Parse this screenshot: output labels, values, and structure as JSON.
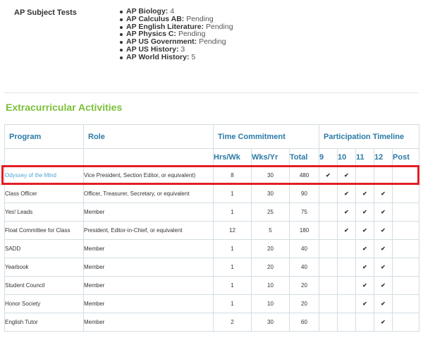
{
  "ap": {
    "label": "AP Subject Tests",
    "items": [
      {
        "subject": "AP Biology:",
        "status": "4"
      },
      {
        "subject": "AP Calculus AB:",
        "status": "Pending"
      },
      {
        "subject": "AP English Literature:",
        "status": "Pending"
      },
      {
        "subject": "AP Physics C:",
        "status": "Pending"
      },
      {
        "subject": "AP US Government:",
        "status": "Pending"
      },
      {
        "subject": "AP US History:",
        "status": "3"
      },
      {
        "subject": "AP World History:",
        "status": "5"
      }
    ]
  },
  "section_title": "Extracurricular Activities",
  "table": {
    "headers": {
      "program": "Program",
      "role": "Role",
      "time_commitment": "Time Commitment",
      "participation": "Participation Timeline",
      "hrs": "Hrs/Wk",
      "wks": "Wks/Yr",
      "total": "Total",
      "g9": "9",
      "g10": "10",
      "g11": "11",
      "g12": "12",
      "post": "Post"
    },
    "check_symbol": "✔",
    "rows": [
      {
        "program": "Odyssey of the Mind",
        "role": "Vice President, Section Editor, or equivalent)",
        "hrs": "8",
        "wks": "30",
        "total": "480",
        "g9": true,
        "g10": true,
        "g11": false,
        "g12": false,
        "post": false
      },
      {
        "program": "Class Officer",
        "role": "Officer, Treasurer, Secretary, or equivalent",
        "hrs": "1",
        "wks": "30",
        "total": "90",
        "g9": false,
        "g10": true,
        "g11": true,
        "g12": true,
        "post": false
      },
      {
        "program": "Yes! Leads",
        "role": "Member",
        "hrs": "1",
        "wks": "25",
        "total": "75",
        "g9": false,
        "g10": true,
        "g11": true,
        "g12": true,
        "post": false
      },
      {
        "program": "Float Committee for Class",
        "role": "President, Editor-in-Chief, or equivalent",
        "hrs": "12",
        "wks": "5",
        "total": "180",
        "g9": false,
        "g10": true,
        "g11": true,
        "g12": true,
        "post": false
      },
      {
        "program": "SADD",
        "role": "Member",
        "hrs": "1",
        "wks": "20",
        "total": "40",
        "g9": false,
        "g10": false,
        "g11": true,
        "g12": true,
        "post": false
      },
      {
        "program": "Yearbook",
        "role": "Member",
        "hrs": "1",
        "wks": "20",
        "total": "40",
        "g9": false,
        "g10": false,
        "g11": true,
        "g12": true,
        "post": false
      },
      {
        "program": "Student Council",
        "role": "Member",
        "hrs": "1",
        "wks": "10",
        "total": "20",
        "g9": false,
        "g10": false,
        "g11": true,
        "g12": true,
        "post": false
      },
      {
        "program": "Honor Society",
        "role": "Member",
        "hrs": "1",
        "wks": "10",
        "total": "20",
        "g9": false,
        "g10": false,
        "g11": true,
        "g12": true,
        "post": false
      },
      {
        "program": "English Tutor",
        "role": "Member",
        "hrs": "2",
        "wks": "30",
        "total": "60",
        "g9": false,
        "g10": false,
        "g11": false,
        "g12": true,
        "post": false
      }
    ]
  },
  "colors": {
    "section_title": "#7bbf3a",
    "header_text": "#2b7aa6",
    "link_text": "#2b87b8",
    "check": "#6dbf45",
    "highlight_border": "#e31e24"
  }
}
